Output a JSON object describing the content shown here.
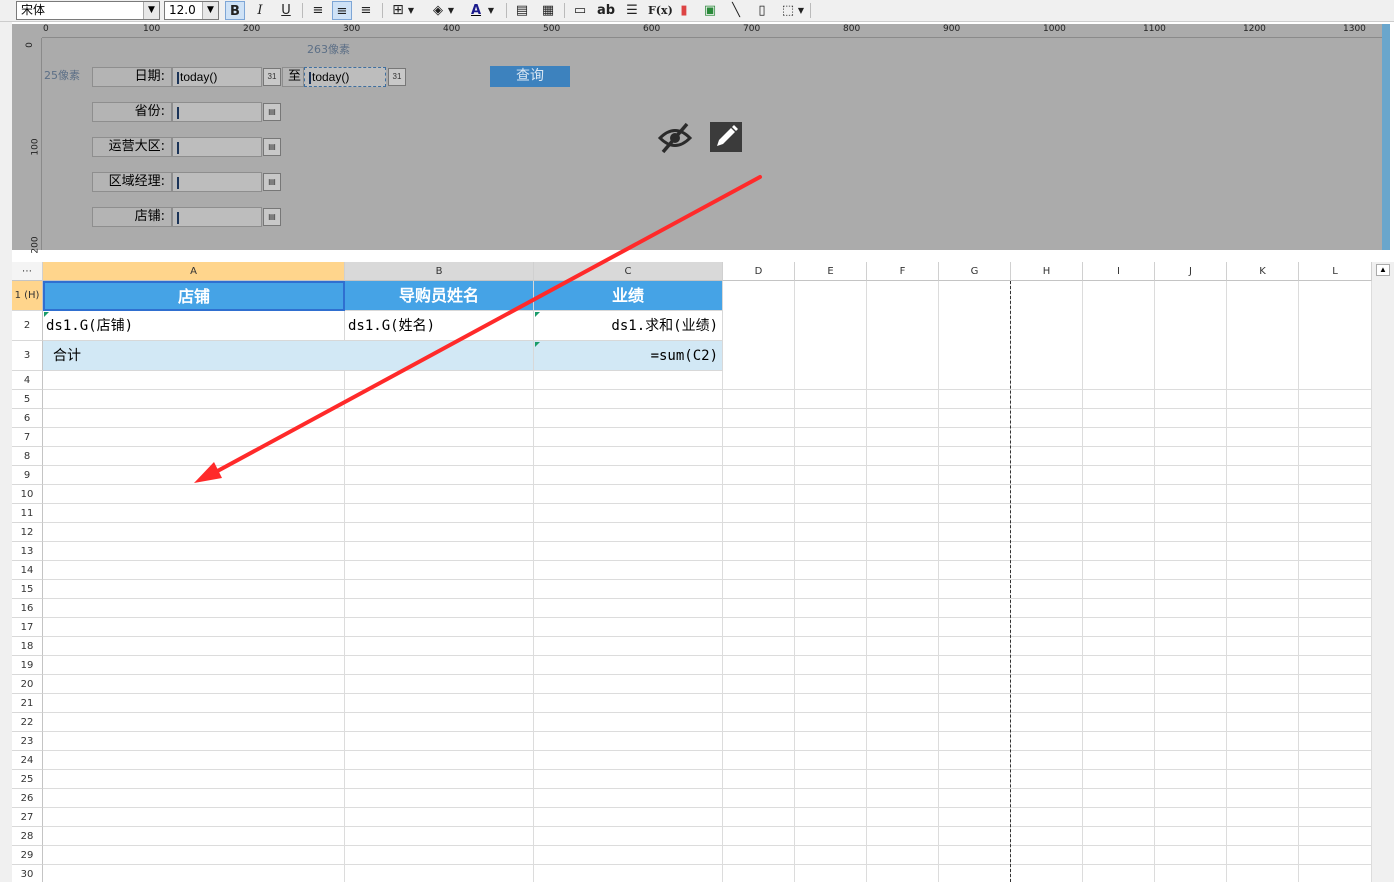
{
  "toolbar": {
    "font_family": "宋体",
    "font_size": "12.0",
    "bold_label": "B",
    "italic_label": "I",
    "underline_label": "U",
    "text_label": "ab",
    "fx_label": "F(x)"
  },
  "param_panel": {
    "ruler_ticks": [
      "0",
      "100",
      "200",
      "300",
      "400",
      "500",
      "600",
      "700",
      "800",
      "900",
      "1000",
      "1100",
      "1200",
      "1300"
    ],
    "vruler_ticks": [
      "0",
      "100",
      "200"
    ],
    "note_top": "263像素",
    "note_left": "25像素",
    "date_label": "日期:",
    "date_from": "today()",
    "to_label": "至",
    "date_to": "today()",
    "date_btn": "31",
    "province_label": "省份:",
    "region_label": "运营大区:",
    "manager_label": "区域经理:",
    "store_label": "店铺:",
    "query_label": "查询"
  },
  "grid": {
    "corner": "⋯",
    "columns": [
      "A",
      "B",
      "C",
      "D",
      "E",
      "F",
      "G",
      "H",
      "I",
      "J",
      "K",
      "L"
    ],
    "rows": [
      "1 (H)",
      "2",
      "3",
      "4",
      "5",
      "6",
      "7",
      "8",
      "9",
      "10",
      "11",
      "12",
      "13",
      "14",
      "15",
      "16",
      "17",
      "18",
      "19",
      "20",
      "21",
      "22",
      "23",
      "24",
      "25",
      "26",
      "27",
      "28",
      "29",
      "30"
    ],
    "header": [
      "店铺",
      "导购员姓名",
      "业绩"
    ],
    "row2": [
      "ds1.G(店铺)",
      "ds1.G(姓名)",
      "ds1.求和(业绩)"
    ],
    "row3": [
      "合计",
      "=sum(C2)"
    ]
  },
  "colors": {
    "header_bg": "#45a3e6",
    "sum_bg": "#d2e8f5",
    "arrow": "#ff2a2a",
    "query_bg": "#3d82be"
  }
}
